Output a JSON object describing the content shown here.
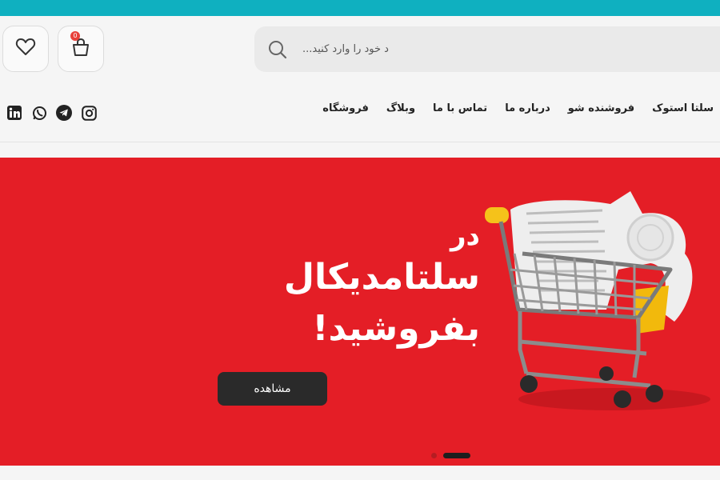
{
  "header": {
    "search_placeholder": "د خود را وارد کنید...",
    "cart_count": "0"
  },
  "nav": {
    "items": [
      "فروشگاه",
      "وبلاگ",
      "تماس با ما",
      "درباره ما",
      "فروشنده شو",
      "سلتا استوک"
    ]
  },
  "social": [
    "linkedin-icon",
    "whatsapp-icon",
    "telegram-icon",
    "instagram-icon"
  ],
  "banner": {
    "line1": "در",
    "line2": "سلتامدیکال",
    "line3": "بفروشید!",
    "cta_label": "مشاهده"
  },
  "colors": {
    "topbar": "#0fb0c0",
    "banner_bg": "#e41e26",
    "cta_bg": "#2a2a2a",
    "badge": "#e8413b"
  }
}
